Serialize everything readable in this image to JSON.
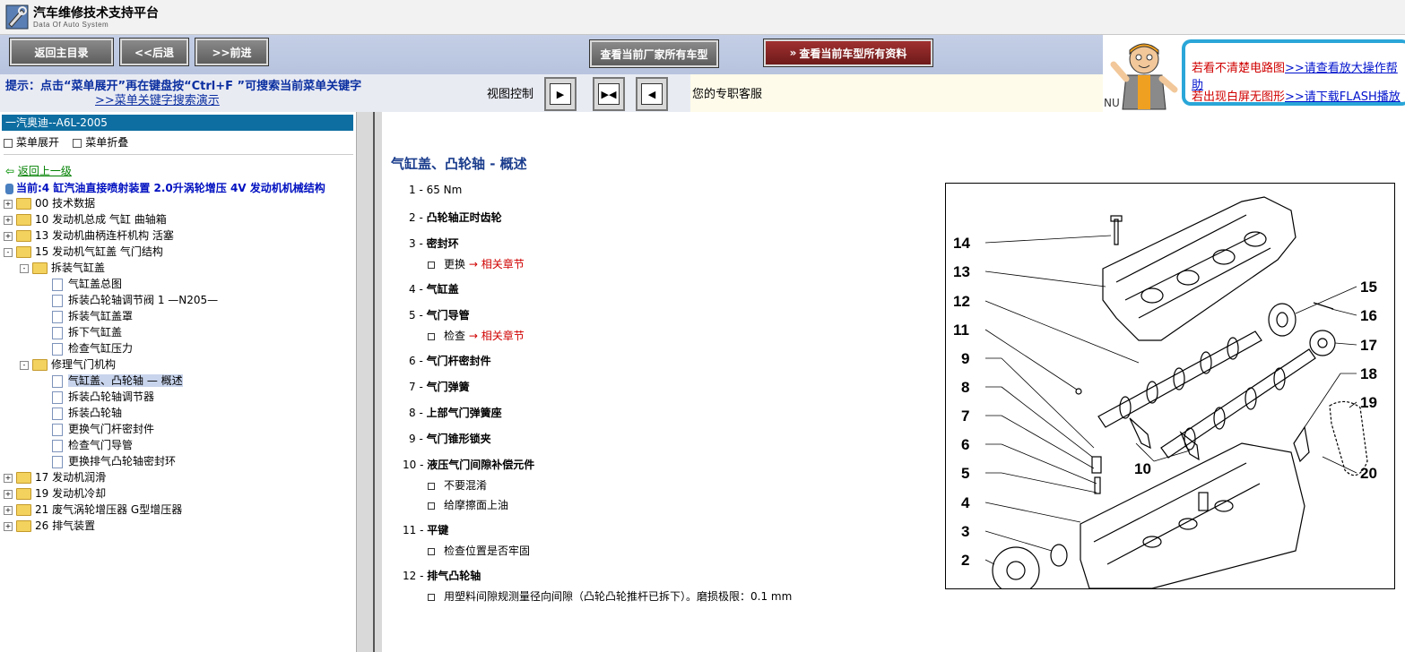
{
  "app": {
    "title": "汽车维修技术支持平台",
    "subtitle": "Data Of Auto System"
  },
  "toolbar": {
    "home": "返回主目录",
    "back": "<<后退",
    "forward": ">>前进",
    "all_models": "查看当前厂家所有车型",
    "all_docs": "查看当前车型所有资料"
  },
  "hint": {
    "text": "提示：点击“菜单展开”再在键盘按“Ctrl+F ”可搜索当前菜单关键字",
    "link": ">>菜单关键字搜索演示"
  },
  "view_control": {
    "label": "视图控制"
  },
  "service": {
    "label": "您的专职客服",
    "nu": "NU"
  },
  "help": {
    "line1_text": "若看不清楚电路图",
    "line1_link": ">>请查看放大操作帮助",
    "line2_text": "若出现白屏无图形",
    "line2_link": ">>请下载FLASH播放"
  },
  "tree": {
    "header": "一汽奥迪--A6L-2005",
    "expand": "菜单展开",
    "collapse": "菜单折叠",
    "back_up": "返回上一级",
    "current": "当前:4 缸汽油直接喷射装置  2.0升涡轮增压  4V 发动机机械结构",
    "items": [
      {
        "label": "00 技术数据",
        "level": 0,
        "type": "folder",
        "toggle": "+"
      },
      {
        "label": "10 发动机总成 气缸 曲轴箱",
        "level": 0,
        "type": "folder",
        "toggle": "+"
      },
      {
        "label": "13 发动机曲柄连杆机构 活塞",
        "level": 0,
        "type": "folder",
        "toggle": "+"
      },
      {
        "label": "15 发动机气缸盖 气门结构",
        "level": 0,
        "type": "folder",
        "toggle": "-"
      },
      {
        "label": "拆装气缸盖",
        "level": 1,
        "type": "folder",
        "toggle": "-"
      },
      {
        "label": "气缸盖总图",
        "level": 2,
        "type": "page"
      },
      {
        "label": "拆装凸轮轴调节阀 1 —N205—",
        "level": 2,
        "type": "page"
      },
      {
        "label": "拆装气缸盖罩",
        "level": 2,
        "type": "page"
      },
      {
        "label": "拆下气缸盖",
        "level": 2,
        "type": "page"
      },
      {
        "label": "检查气缸压力",
        "level": 2,
        "type": "page"
      },
      {
        "label": "修理气门机构",
        "level": 1,
        "type": "folder",
        "toggle": "-"
      },
      {
        "label": "气缸盖、凸轮轴 — 概述",
        "level": 2,
        "type": "page",
        "selected": true
      },
      {
        "label": "拆装凸轮轴调节器",
        "level": 2,
        "type": "page"
      },
      {
        "label": "拆装凸轮轴",
        "level": 2,
        "type": "page"
      },
      {
        "label": "更换气门杆密封件",
        "level": 2,
        "type": "page"
      },
      {
        "label": "检查气门导管",
        "level": 2,
        "type": "page"
      },
      {
        "label": "更换排气凸轮轴密封环",
        "level": 2,
        "type": "page"
      },
      {
        "label": "17 发动机润滑",
        "level": 0,
        "type": "folder",
        "toggle": "+"
      },
      {
        "label": "19 发动机冷却",
        "level": 0,
        "type": "folder",
        "toggle": "+"
      },
      {
        "label": "21 废气涡轮增压器 G型增压器",
        "level": 0,
        "type": "folder",
        "toggle": "+"
      },
      {
        "label": "26 排气装置",
        "level": 0,
        "type": "folder",
        "toggle": "+"
      }
    ]
  },
  "content": {
    "title": "气缸盖、凸轮轴  - 概述",
    "items": [
      {
        "num": "1",
        "label": "65 Nm",
        "bold": false,
        "subs": []
      },
      {
        "num": "2",
        "label": "凸轮轴正时齿轮",
        "bold": true,
        "subs": []
      },
      {
        "num": "3",
        "label": "密封环",
        "bold": true,
        "subs": [
          {
            "text": "更换",
            "link": "→ 相关章节"
          }
        ]
      },
      {
        "num": "4",
        "label": "气缸盖",
        "bold": true,
        "subs": []
      },
      {
        "num": "5",
        "label": "气门导管",
        "bold": true,
        "subs": [
          {
            "text": "检查",
            "link": "→ 相关章节"
          }
        ]
      },
      {
        "num": "6",
        "label": "气门杆密封件",
        "bold": true,
        "subs": []
      },
      {
        "num": "7",
        "label": "气门弹簧",
        "bold": true,
        "subs": []
      },
      {
        "num": "8",
        "label": "上部气门弹簧座",
        "bold": true,
        "subs": []
      },
      {
        "num": "9",
        "label": "气门锥形锁夹",
        "bold": true,
        "subs": []
      },
      {
        "num": "10",
        "label": "液压气门间隙补偿元件",
        "bold": true,
        "subs": [
          {
            "text": "不要混淆",
            "link": ""
          },
          {
            "text": "给摩擦面上油",
            "link": ""
          }
        ]
      },
      {
        "num": "11",
        "label": "平键",
        "bold": true,
        "subs": [
          {
            "text": "检查位置是否牢固",
            "link": ""
          }
        ]
      },
      {
        "num": "12",
        "label": "排气凸轮轴",
        "bold": true,
        "subs": [
          {
            "text": "用塑料间隙规测量径向间隙（凸轮凸轮推杆已拆下）。磨损极限：0.1 mm",
            "link": ""
          }
        ]
      }
    ]
  },
  "diagram": {
    "callouts": [
      "14",
      "13",
      "12",
      "11",
      "9",
      "8",
      "7",
      "6",
      "5",
      "4",
      "3",
      "2",
      "15",
      "16",
      "17",
      "18",
      "19",
      "20",
      "10"
    ]
  }
}
